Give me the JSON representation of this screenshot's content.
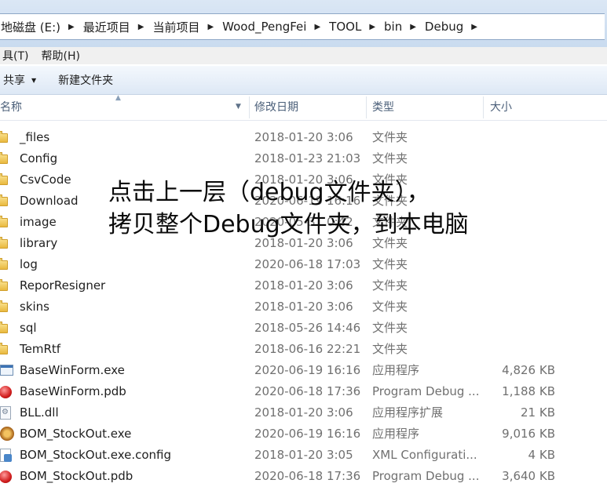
{
  "address": {
    "crumbs": [
      "地磁盘 (E:)",
      "最近项目",
      "当前项目",
      "Wood_PengFei",
      "TOOL",
      "bin",
      "Debug"
    ]
  },
  "menu": {
    "items": [
      "具(T)",
      "帮助(H)"
    ]
  },
  "toolbar": {
    "share_label": "共享",
    "new_folder_label": "新建文件夹"
  },
  "columns": {
    "name": "名称",
    "date": "修改日期",
    "type": "类型",
    "size": "大小"
  },
  "files": [
    {
      "name": "_files",
      "date": "2018-01-20 3:06",
      "type": "文件夹",
      "size": "",
      "icon": "folder-icon"
    },
    {
      "name": "Config",
      "date": "2018-01-23 21:03",
      "type": "文件夹",
      "size": "",
      "icon": "folder-icon"
    },
    {
      "name": "CsvCode",
      "date": "2018-01-20 3:06",
      "type": "文件夹",
      "size": "",
      "icon": "folder-icon"
    },
    {
      "name": "Download",
      "date": "2020-06-19 16:16",
      "type": "文件夹",
      "size": "",
      "icon": "folder-icon"
    },
    {
      "name": "image",
      "date": "2020-05-31 0:42",
      "type": "文件夹",
      "size": "",
      "icon": "folder-icon"
    },
    {
      "name": "library",
      "date": "2018-01-20 3:06",
      "type": "文件夹",
      "size": "",
      "icon": "folder-icon"
    },
    {
      "name": "log",
      "date": "2020-06-18 17:03",
      "type": "文件夹",
      "size": "",
      "icon": "folder-icon"
    },
    {
      "name": "ReporResigner",
      "date": "2018-01-20 3:06",
      "type": "文件夹",
      "size": "",
      "icon": "folder-icon"
    },
    {
      "name": "skins",
      "date": "2018-01-20 3:06",
      "type": "文件夹",
      "size": "",
      "icon": "folder-icon"
    },
    {
      "name": "sql",
      "date": "2018-05-26 14:46",
      "type": "文件夹",
      "size": "",
      "icon": "folder-icon"
    },
    {
      "name": "TemRtf",
      "date": "2018-06-16 22:21",
      "type": "文件夹",
      "size": "",
      "icon": "folder-icon"
    },
    {
      "name": "BaseWinForm.exe",
      "date": "2020-06-19 16:16",
      "type": "应用程序",
      "size": "4,826 KB",
      "icon": "exe-icon"
    },
    {
      "name": "BaseWinForm.pdb",
      "date": "2020-06-18 17:36",
      "type": "Program Debug ...",
      "size": "1,188 KB",
      "icon": "pdb-icon"
    },
    {
      "name": "BLL.dll",
      "date": "2018-01-20 3:06",
      "type": "应用程序扩展",
      "size": "21 KB",
      "icon": "dll-icon"
    },
    {
      "name": "BOM_StockOut.exe",
      "date": "2020-06-19 16:16",
      "type": "应用程序",
      "size": "9,016 KB",
      "icon": "bom-exe-icon"
    },
    {
      "name": "BOM_StockOut.exe.config",
      "date": "2018-01-20 3:05",
      "type": "XML Configurati...",
      "size": "4 KB",
      "icon": "config-icon"
    },
    {
      "name": "BOM_StockOut.pdb",
      "date": "2020-06-18 17:36",
      "type": "Program Debug ...",
      "size": "3,640 KB",
      "icon": "pdb-icon"
    }
  ],
  "overlay": {
    "line1": "点击上一层（debug文件夹），",
    "line2": "拷贝整个Debug文件夹，到本电脑"
  }
}
